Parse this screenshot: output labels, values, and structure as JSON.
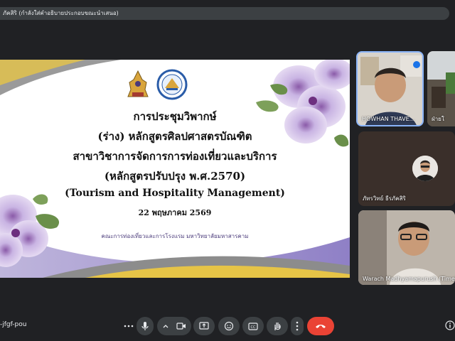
{
  "caption_bar": {
    "text": "ภัคสิริ (กำลังใส่คำอธิบายประกอบขณะนำเสนอ)"
  },
  "slide": {
    "line1": "การประชุมวิพากษ์",
    "line2": "(ร่าง) หลักสูตรศิลปศาสตรบัณฑิต",
    "line3": "สาขาวิชาการจัดการการท่องเที่ยวและบริการ",
    "line4": "(หลักสูตรปรับปรุง พ.ศ.2570)",
    "line5": "(Tourism and Hospitality Management)",
    "date": "22 พฤษภาคม 2569",
    "faculty": "คณะการท่องเที่ยวและการโรงแรม มหาวิทยาลัยมหาสารคาม"
  },
  "participants": [
    {
      "name": "HOWHAN THAVE..."
    },
    {
      "name": "ฝ่ายใ"
    },
    {
      "name": "ภัทรวิทย์ ธีรภัคสิริ"
    },
    {
      "name": "Warach Madhyamapurush (TimeZ"
    }
  ],
  "meeting_code": "-jfgf-pou",
  "colors": {
    "background": "#202124",
    "tile_border": "#8ab4f8",
    "end_call": "#ea4335",
    "control": "#3c4043"
  },
  "icons": [
    "more-options-icon",
    "microphone-icon",
    "chevron-up-icon",
    "camera-icon",
    "present-icon",
    "emoji-icon",
    "captions-icon",
    "raise-hand-icon",
    "more-vert-icon",
    "end-call-icon",
    "info-icon"
  ]
}
